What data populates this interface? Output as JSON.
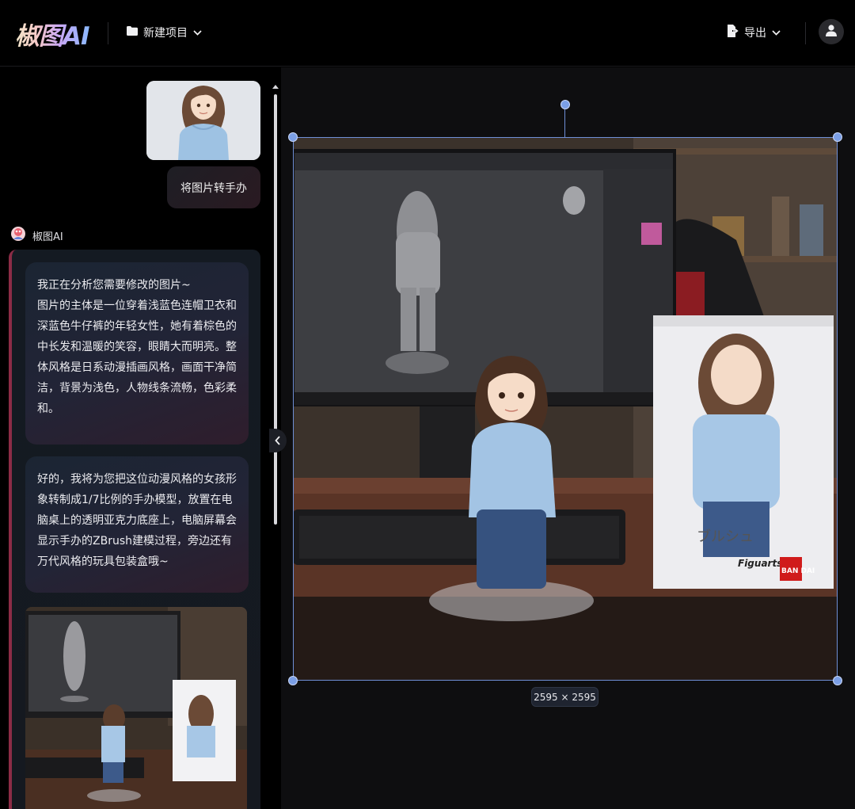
{
  "app": {
    "logo": "椒图AI"
  },
  "header": {
    "project_label": "新建项目",
    "export_label": "导出"
  },
  "chat": {
    "user_message": "将图片转手办",
    "ai_name": "椒图AI",
    "ai_messages": [
      "我正在分析您需要修改的图片~\n图片的主体是一位穿着浅蓝色连帽卫衣和深蓝色牛仔裤的年轻女性，她有着棕色的中长发和温暖的笑容，眼睛大而明亮。整体风格是日系动漫插画风格，画面干净简洁，背景为浅色，人物线条流畅，色彩柔和。",
      "好的，我将为您把这位动漫风格的女孩形象转制成1/7比例的手办模型，放置在电脑桌上的透明亚克力底座上，电脑屏幕会显示手办的ZBrush建模过程，旁边还有万代风格的玩具包装盒哦~"
    ]
  },
  "canvas": {
    "dimensions_label": "2595 × 2595",
    "box_brand_1": "Figuarts",
    "box_brand_2": "BAN DAI",
    "box_text": "ブルシュ"
  },
  "icons": {
    "project": "folder-icon",
    "project_caret": "chevron-down-icon",
    "export": "export-file-icon",
    "export_caret": "chevron-down-icon",
    "user": "user-icon",
    "ai": "ai-avatar-icon",
    "collapse": "chevron-left-icon"
  },
  "colors": {
    "accent": "#7b9fe6",
    "ai_border": "#8b2c46",
    "background": "#000000"
  }
}
